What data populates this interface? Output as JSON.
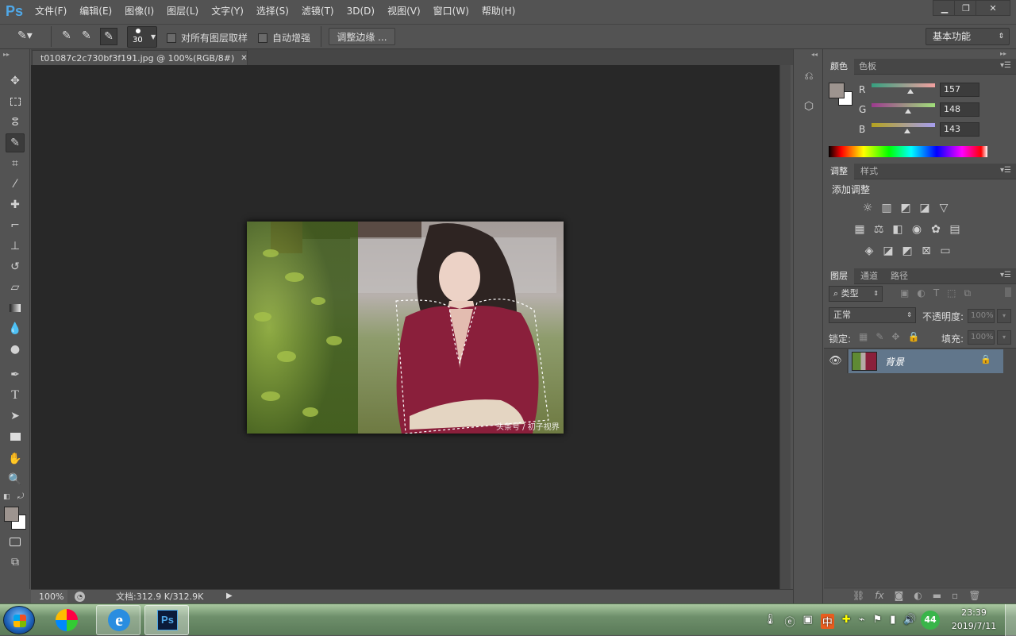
{
  "app": {
    "logo": "Ps",
    "menus": [
      "文件(F)",
      "编辑(E)",
      "图像(I)",
      "图层(L)",
      "文字(Y)",
      "选择(S)",
      "滤镜(T)",
      "3D(D)",
      "视图(V)",
      "窗口(W)",
      "帮助(H)"
    ],
    "window_controls": {
      "minimize": "minimize-icon",
      "restore": "restore-icon",
      "close": "close-icon"
    }
  },
  "options": {
    "brush_size": "30",
    "sample_all_layers": "对所有图层取样",
    "auto_enhance": "自动增强",
    "refine_edge": "调整边缘 ...",
    "workspace": "基本功能"
  },
  "document": {
    "tab_title": "t01087c2c730bf3f191.jpg @ 100%(RGB/8#)",
    "watermark": "头条号 / 初子视界",
    "zoom": "100%",
    "doc_size": "文档:312.9 K/312.9K"
  },
  "color_panel": {
    "tabs": [
      "颜色",
      "色板"
    ],
    "channels": [
      {
        "label": "R",
        "value": "157",
        "fraction": 0.615
      },
      {
        "label": "G",
        "value": "148",
        "fraction": 0.58
      },
      {
        "label": "B",
        "value": "143",
        "fraction": 0.56
      }
    ],
    "foreground": "#9d948f",
    "background": "#ffffff"
  },
  "adjust_panel": {
    "tabs": [
      "调整",
      "样式"
    ],
    "heading": "添加调整"
  },
  "layers_panel": {
    "tabs": [
      "图层",
      "通道",
      "路径"
    ],
    "filter": "类型",
    "blend_mode": "正常",
    "opacity_label": "不透明度:",
    "opacity": "100%",
    "lock_label": "锁定:",
    "fill_label": "填充:",
    "fill": "100%",
    "layers": [
      {
        "name": "背景",
        "visible": true,
        "locked": true
      }
    ]
  },
  "taskbar": {
    "time": "23:39",
    "date": "2019/7/11",
    "badge": "44",
    "apps": [
      "start-orb",
      "360-icon",
      "ie-icon",
      "ps-icon"
    ]
  },
  "colors": {
    "accent": "#4fa8e8",
    "panel": "#535353",
    "canvas": "#282828"
  }
}
